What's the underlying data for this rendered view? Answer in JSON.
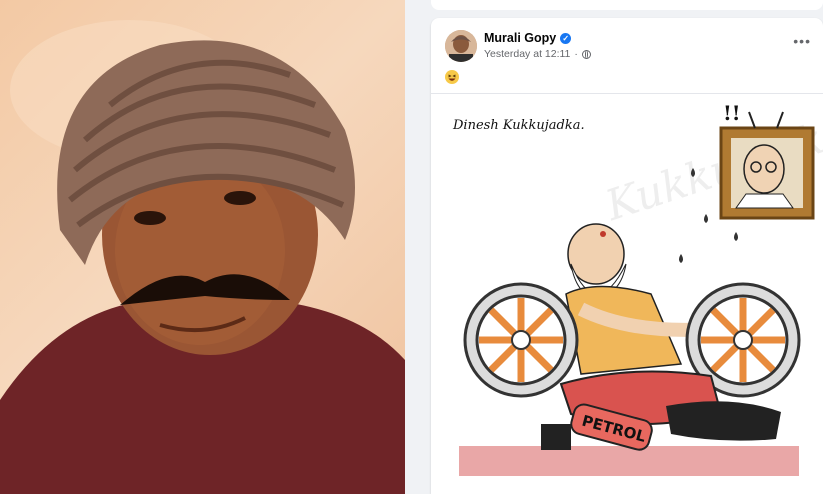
{
  "left_photo": {
    "icon": "portrait-photo"
  },
  "post": {
    "author": "Murali Gopy",
    "verified_icon": "verified-badge-icon",
    "time": "Yesterday at 12:11",
    "separator": "·",
    "audience_icon": "globe-icon",
    "more_label": "•••",
    "emoji_icon": "laughing-emoji-icon",
    "image": {
      "signature": "Dinesh Kukkujadka.",
      "watermark": "Kukkujadka",
      "exclaim": "!!",
      "petrol_label": "PETROL"
    }
  },
  "colors": {
    "accent": "#1877f2",
    "background": "#f0f2f5"
  }
}
